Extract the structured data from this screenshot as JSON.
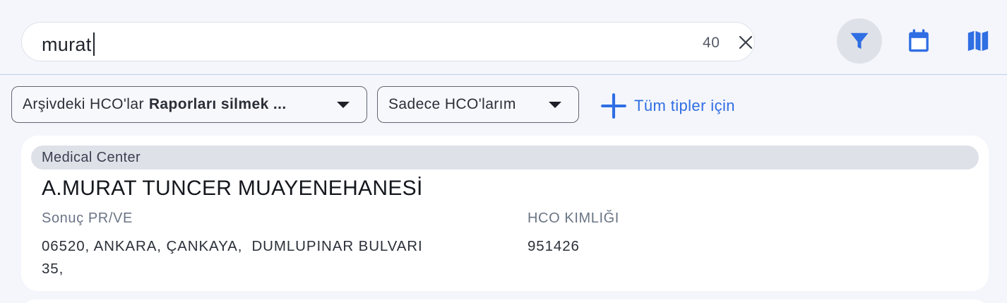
{
  "search": {
    "value": "murat",
    "result_count": "40"
  },
  "header_icons": {
    "filter": "filter-icon",
    "calendar": "calendar-icon",
    "map": "map-icon",
    "active": "filter",
    "active_bg": "#dfe1e8",
    "icon_color": "#2f6ee3"
  },
  "filters": {
    "archive_dropdown": {
      "prefix": "Arşivdeki HCO'lar",
      "value": "Raporları silmek ..."
    },
    "scope_dropdown": {
      "value": "Sadece HCO'larım"
    },
    "add_type_label": "Tüm tipler için"
  },
  "results": [
    {
      "type": "Medical Center",
      "name": "A.MURAT TUNCER MUAYENEHANESİ",
      "address_label": "Sonuç PR/VE",
      "address_line1": "06520, ANKARA, ÇANKAYA,  DUMLUPINAR BULVARI",
      "address_line2": "35,",
      "hco_id_label": "HCO KIMLIĞI",
      "hco_id": "951426"
    }
  ],
  "colors": {
    "accent": "#2f6ee3",
    "background": "#f5f6fb",
    "card": "#ffffff",
    "chip": "#dfe1e9"
  }
}
